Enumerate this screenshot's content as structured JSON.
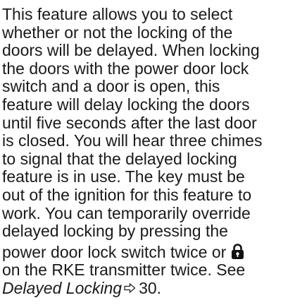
{
  "paragraph": {
    "lines": [
      "This feature allows you to select",
      "whether or not the locking of the",
      "doors will be delayed. When locking",
      "the doors with the power door lock",
      "switch and a door is open, this",
      "feature will delay locking the doors",
      "until five seconds after the last door",
      "is closed. You will hear three chimes",
      "to signal that the delayed locking",
      "feature is in use. The key must be",
      "out of the ignition for this feature to",
      "work. You can temporarily override",
      "delayed locking by pressing the"
    ],
    "line14_before_icon": "power door lock switch twice or ",
    "line15_after_icon": "on the RKE transmitter twice. See",
    "xref_title": "Delayed Locking",
    "xref_page": "30",
    "xref_end": "."
  },
  "icons": {
    "lock": "lock-icon",
    "xref_arrow": "page-reference-arrow-icon"
  }
}
